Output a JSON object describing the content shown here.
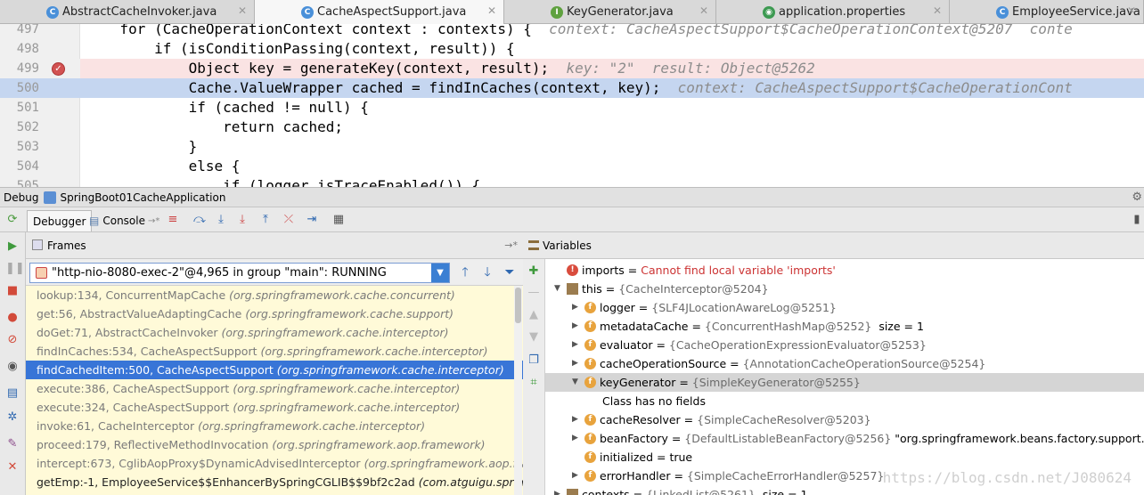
{
  "tabs": [
    {
      "label": "AbstractCacheInvoker.java",
      "icon_color": "#4a90d9",
      "icon": "C",
      "active": false,
      "width": 286
    },
    {
      "label": "CacheAspectSupport.java",
      "icon_color": "#4a90d9",
      "icon": "C",
      "active": true,
      "width": 280
    },
    {
      "label": "KeyGenerator.java",
      "icon_color": "#5fa13f",
      "icon": "I",
      "active": false,
      "width": 238
    },
    {
      "label": "application.properties",
      "icon_color": "#3d9a52",
      "icon": "◉",
      "active": false,
      "width": 262
    },
    {
      "label": "EmployeeService.java",
      "icon_color": "#4a90d9",
      "icon": "C",
      "active": false,
      "width": 218
    }
  ],
  "editor": {
    "lines": [
      {
        "num": "497",
        "code": "    for (CacheOperationContext context : contexts) {",
        "hint": "  context: CacheAspectSupport$CacheOperationContext@5207  conte",
        "state": ""
      },
      {
        "num": "498",
        "code": "        if (isConditionPassing(context, result)) {",
        "hint": "",
        "state": ""
      },
      {
        "num": "499",
        "code": "            Object key = generateKey(context, result);",
        "hint": "  key: \"2\"  result: Object@5262",
        "state": "bp"
      },
      {
        "num": "500",
        "code": "            Cache.ValueWrapper cached = findInCaches(context, key);",
        "hint": "  context: CacheAspectSupport$CacheOperationCont",
        "state": "cur"
      },
      {
        "num": "501",
        "code": "            if (cached != null) {",
        "hint": "",
        "state": ""
      },
      {
        "num": "502",
        "code": "                return cached;",
        "hint": "",
        "state": ""
      },
      {
        "num": "503",
        "code": "            }",
        "hint": "",
        "state": ""
      },
      {
        "num": "504",
        "code": "            else {",
        "hint": "",
        "state": ""
      },
      {
        "num": "505",
        "code": "                if (logger.isTraceEnabled()) {",
        "hint": "",
        "state": ""
      }
    ]
  },
  "debug": {
    "title": "Debug",
    "config": "SpringBoot01CacheApplication",
    "tab_debugger": "Debugger",
    "tab_console": "Console"
  },
  "frames": {
    "header": "Frames",
    "thread": "\"http-nio-8080-exec-2\"@4,965 in group \"main\": RUNNING",
    "items": [
      {
        "method": "lookup:134, ConcurrentMapCache",
        "pkg": "(org.springframework.cache.concurrent)",
        "selected": false,
        "dark": false
      },
      {
        "method": "get:56, AbstractValueAdaptingCache",
        "pkg": "(org.springframework.cache.support)",
        "selected": false,
        "dark": false
      },
      {
        "method": "doGet:71, AbstractCacheInvoker",
        "pkg": "(org.springframework.cache.interceptor)",
        "selected": false,
        "dark": false
      },
      {
        "method": "findInCaches:534, CacheAspectSupport",
        "pkg": "(org.springframework.cache.interceptor)",
        "selected": false,
        "dark": false
      },
      {
        "method": "findCachedItem:500, CacheAspectSupport",
        "pkg": "(org.springframework.cache.interceptor)",
        "selected": true,
        "dark": false
      },
      {
        "method": "execute:386, CacheAspectSupport",
        "pkg": "(org.springframework.cache.interceptor)",
        "selected": false,
        "dark": false
      },
      {
        "method": "execute:324, CacheAspectSupport",
        "pkg": "(org.springframework.cache.interceptor)",
        "selected": false,
        "dark": false
      },
      {
        "method": "invoke:61, CacheInterceptor",
        "pkg": "(org.springframework.cache.interceptor)",
        "selected": false,
        "dark": false
      },
      {
        "method": "proceed:179, ReflectiveMethodInvocation",
        "pkg": "(org.springframework.aop.framework)",
        "selected": false,
        "dark": false
      },
      {
        "method": "intercept:673, CglibAopProxy$DynamicAdvisedInterceptor",
        "pkg": "(org.springframework.aop.framewo",
        "selected": false,
        "dark": false
      },
      {
        "method": "getEmp:-1, EmployeeService$$EnhancerBySpringCGLIB$$9bf2c2ad",
        "pkg": "(com.atguigu.springboot.s",
        "selected": false,
        "dark": true
      }
    ]
  },
  "variables": {
    "header": "Variables",
    "rows": [
      {
        "indent": 0,
        "tri": "",
        "icon": "!",
        "icon_kind": "warn",
        "name": "imports",
        "eq": " = ",
        "value": "Cannot find local variable 'imports'",
        "value_kind": "error",
        "extra": "",
        "selected": false
      },
      {
        "indent": 0,
        "tri": "▼",
        "icon": "",
        "icon_kind": "list",
        "name": "this",
        "eq": " = ",
        "value": "{CacheInterceptor@5204}",
        "value_kind": "type",
        "extra": "",
        "selected": false
      },
      {
        "indent": 1,
        "tri": "▶",
        "icon": "f",
        "icon_kind": "field",
        "name": "logger",
        "eq": " = ",
        "value": "{SLF4JLocationAwareLog@5251}",
        "value_kind": "type",
        "extra": "",
        "selected": false
      },
      {
        "indent": 1,
        "tri": "▶",
        "icon": "f",
        "icon_kind": "field",
        "name": "metadataCache",
        "eq": " = ",
        "value": "{ConcurrentHashMap@5252}",
        "value_kind": "type",
        "extra": "  size = 1",
        "selected": false
      },
      {
        "indent": 1,
        "tri": "▶",
        "icon": "f",
        "icon_kind": "field",
        "name": "evaluator",
        "eq": " = ",
        "value": "{CacheOperationExpressionEvaluator@5253}",
        "value_kind": "type",
        "extra": "",
        "selected": false
      },
      {
        "indent": 1,
        "tri": "▶",
        "icon": "f",
        "icon_kind": "field",
        "name": "cacheOperationSource",
        "eq": " = ",
        "value": "{AnnotationCacheOperationSource@5254}",
        "value_kind": "type",
        "extra": "",
        "selected": false
      },
      {
        "indent": 1,
        "tri": "▼",
        "icon": "f",
        "icon_kind": "field",
        "name": "keyGenerator",
        "eq": " = ",
        "value": "{SimpleKeyGenerator@5255}",
        "value_kind": "type",
        "extra": "",
        "selected": true
      },
      {
        "indent": 2,
        "tri": "",
        "icon": "",
        "icon_kind": "none",
        "name": "Class has no fields",
        "eq": "",
        "value": "",
        "value_kind": "type",
        "extra": "",
        "selected": false
      },
      {
        "indent": 1,
        "tri": "▶",
        "icon": "f",
        "icon_kind": "field",
        "name": "cacheResolver",
        "eq": " = ",
        "value": "{SimpleCacheResolver@5203}",
        "value_kind": "type",
        "extra": "",
        "selected": false
      },
      {
        "indent": 1,
        "tri": "▶",
        "icon": "f",
        "icon_kind": "field",
        "name": "beanFactory",
        "eq": " = ",
        "value": "{DefaultListableBeanFactory@5256}",
        "value_kind": "type",
        "extra": " \"org.springframework.beans.factory.support.DefaultL...",
        "selected": false
      },
      {
        "indent": 1,
        "tri": "",
        "icon": "f",
        "icon_kind": "field",
        "name": "initialized",
        "eq": " = ",
        "value": "true",
        "value_kind": "plain",
        "extra": "",
        "selected": false
      },
      {
        "indent": 1,
        "tri": "▶",
        "icon": "f",
        "icon_kind": "field",
        "name": "errorHandler",
        "eq": " = ",
        "value": "{SimpleCacheErrorHandler@5257}",
        "value_kind": "type",
        "extra": "",
        "selected": false
      },
      {
        "indent": 0,
        "tri": "▶",
        "icon": "",
        "icon_kind": "list",
        "name": "contexts",
        "eq": " = ",
        "value": "{LinkedList@5261}",
        "value_kind": "type",
        "extra": "  size = 1",
        "selected": false
      }
    ]
  },
  "watermark": "https://blog.csdn.net/J080624"
}
